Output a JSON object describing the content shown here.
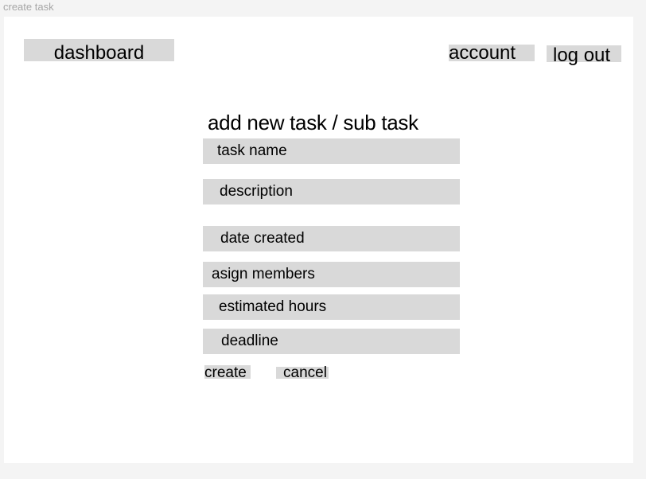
{
  "frame_title": "create task",
  "header": {
    "dashboard_label": "dashboard",
    "account_label": "account",
    "logout_label": "log out"
  },
  "form": {
    "title": "add new task / sub task",
    "fields": {
      "task_name": "task name",
      "description": "description",
      "date_created": "date created",
      "assign_members": "asign members",
      "estimated_hours": "estimated hours",
      "deadline": "deadline"
    },
    "create_label": "create",
    "cancel_label": "cancel"
  },
  "colors": {
    "page_background": "#f4f4f4",
    "frame_background": "#ffffff",
    "block_gray": "#d9d9d9",
    "frame_title_text": "#a6a6a6"
  }
}
